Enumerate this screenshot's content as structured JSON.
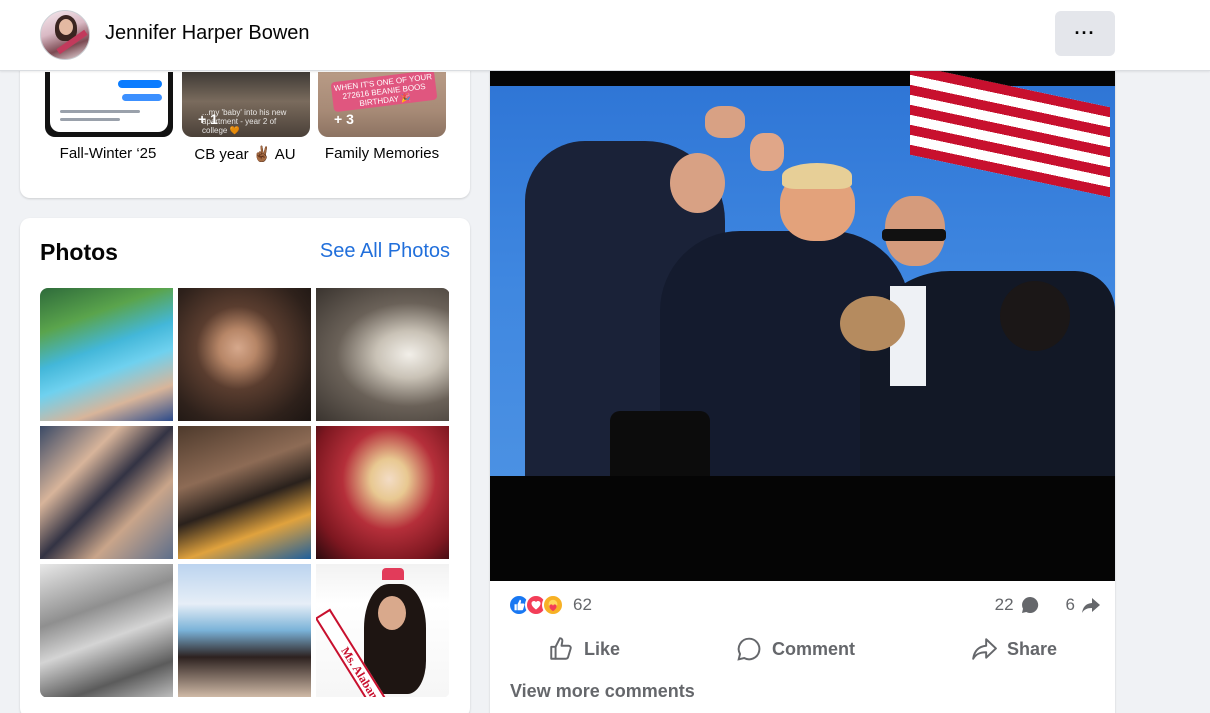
{
  "header": {
    "profile_name": "Jennifer Harper Bowen",
    "more_label": "···"
  },
  "highlights": {
    "items": [
      {
        "label": "Fall-Winter ‘25",
        "count": ""
      },
      {
        "label": "CB year ✌🏾 AU",
        "count": "+ 1",
        "caption": "...my 'baby' into his new apartment - year 2 of college 🧡"
      },
      {
        "label": "Family Memories",
        "count": "+ 3",
        "caption": "WHEN IT'S ONE OF YOUR 272616 BEANIE BOOS BIRTHDAY 🎉"
      }
    ]
  },
  "photos": {
    "title": "Photos",
    "see_all": "See All Photos",
    "grid_sash_text": "Ms. Alabama"
  },
  "post": {
    "reaction_count": "62",
    "comment_count": "22",
    "share_count": "6",
    "like_label": "Like",
    "comment_label": "Comment",
    "share_label": "Share",
    "view_more_comments": "View more comments"
  },
  "colors": {
    "link_blue": "#216fdb",
    "like_blue": "#1877f2",
    "love_red": "#f33e58",
    "care_yellow": "#f7b125",
    "secondary_text": "#65676b"
  },
  "icons": [
    "more-icon",
    "like-reaction-icon",
    "love-reaction-icon",
    "care-reaction-icon",
    "comment-count-icon",
    "share-count-icon",
    "thumbs-up-icon",
    "comment-icon",
    "share-icon"
  ]
}
